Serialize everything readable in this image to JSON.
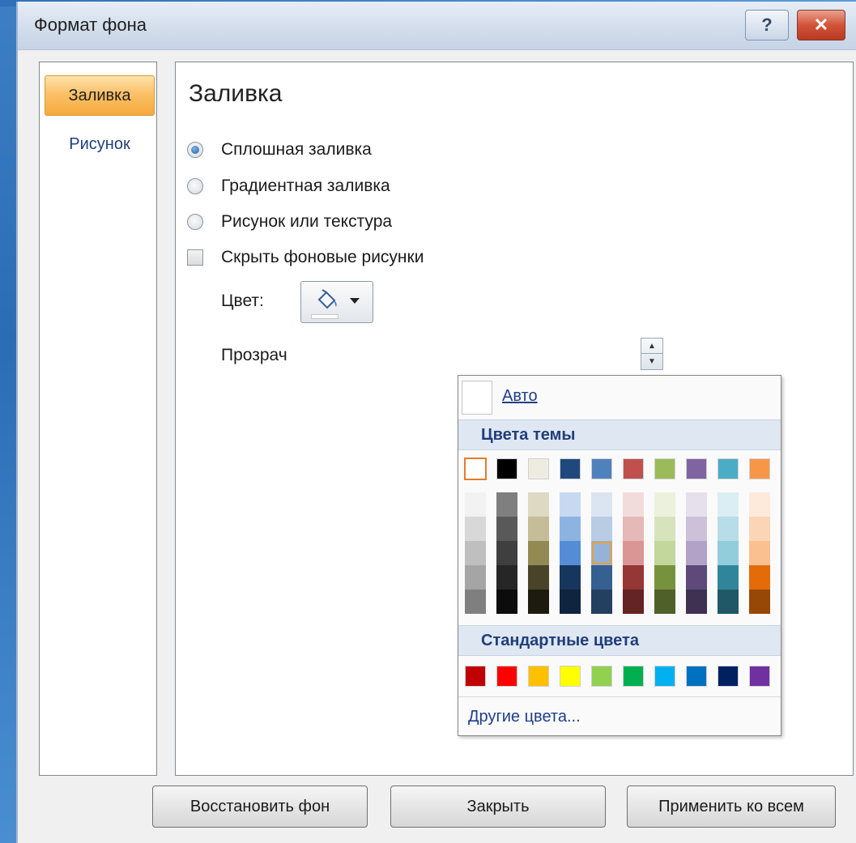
{
  "window": {
    "title": "Формат фона",
    "help_label": "?",
    "close_label": "✕"
  },
  "nav": {
    "items": [
      {
        "label": "Заливка",
        "active": true
      },
      {
        "label": "Рисунок",
        "active": false
      }
    ]
  },
  "fill": {
    "section_title": "Заливка",
    "options": [
      {
        "label": "Сплошная заливка",
        "type": "radio",
        "checked": true
      },
      {
        "label": "Градиентная заливка",
        "type": "radio",
        "checked": false
      },
      {
        "label": "Рисунок или текстура",
        "type": "radio",
        "checked": false
      },
      {
        "label": "Скрыть фоновые рисунки",
        "type": "checkbox",
        "checked": false
      }
    ],
    "color_label": "Цвет:",
    "color_icon": "paint-bucket-icon",
    "transparency_label": "Прозрач"
  },
  "palette": {
    "auto_label": "Авто",
    "theme_header": "Цвета темы",
    "theme_colors": [
      "#FFFFFF",
      "#000000",
      "#EEECE1",
      "#1F497D",
      "#4F81BD",
      "#C0504D",
      "#9BBB59",
      "#8064A2",
      "#4BACC6",
      "#F79646"
    ],
    "theme_shades": [
      [
        "#F2F2F2",
        "#D8D8D8",
        "#BFBFBF",
        "#A5A5A5",
        "#7F7F7F"
      ],
      [
        "#7F7F7F",
        "#595959",
        "#3F3F3F",
        "#262626",
        "#0C0C0C"
      ],
      [
        "#DDD9C3",
        "#C4BD97",
        "#938953",
        "#494429",
        "#1D1B10"
      ],
      [
        "#C6D9F0",
        "#8DB3E2",
        "#548DD4",
        "#17365D",
        "#0F243E"
      ],
      [
        "#DBE5F1",
        "#B8CCE4",
        "#95B3D7",
        "#366092",
        "#244061"
      ],
      [
        "#F2DCDB",
        "#E5B9B7",
        "#D99694",
        "#953734",
        "#632423"
      ],
      [
        "#EBF1DD",
        "#D7E3BC",
        "#C3D69B",
        "#76923C",
        "#4F6128"
      ],
      [
        "#E5E0EC",
        "#CCC1D9",
        "#B2A2C7",
        "#5F497A",
        "#3F3151"
      ],
      [
        "#DBEEF3",
        "#B7DDE8",
        "#92CDDC",
        "#31859B",
        "#205867"
      ],
      [
        "#FDEADA",
        "#FBD5B5",
        "#FAC08F",
        "#E36C09",
        "#974806"
      ]
    ],
    "selected_theme_index": 0,
    "selected_shade": [
      4,
      2
    ],
    "standard_header": "Стандартные цвета",
    "standard_colors": [
      "#C00000",
      "#FF0000",
      "#FFC000",
      "#FFFF00",
      "#92D050",
      "#00B050",
      "#00B0F0",
      "#0070C0",
      "#002060",
      "#7030A0"
    ],
    "more_colors_label": "Другие цвета..."
  },
  "footer": {
    "reset_label": "Восстановить фон",
    "close_label": "Закрыть",
    "apply_all_label": "Применить ко всем"
  }
}
